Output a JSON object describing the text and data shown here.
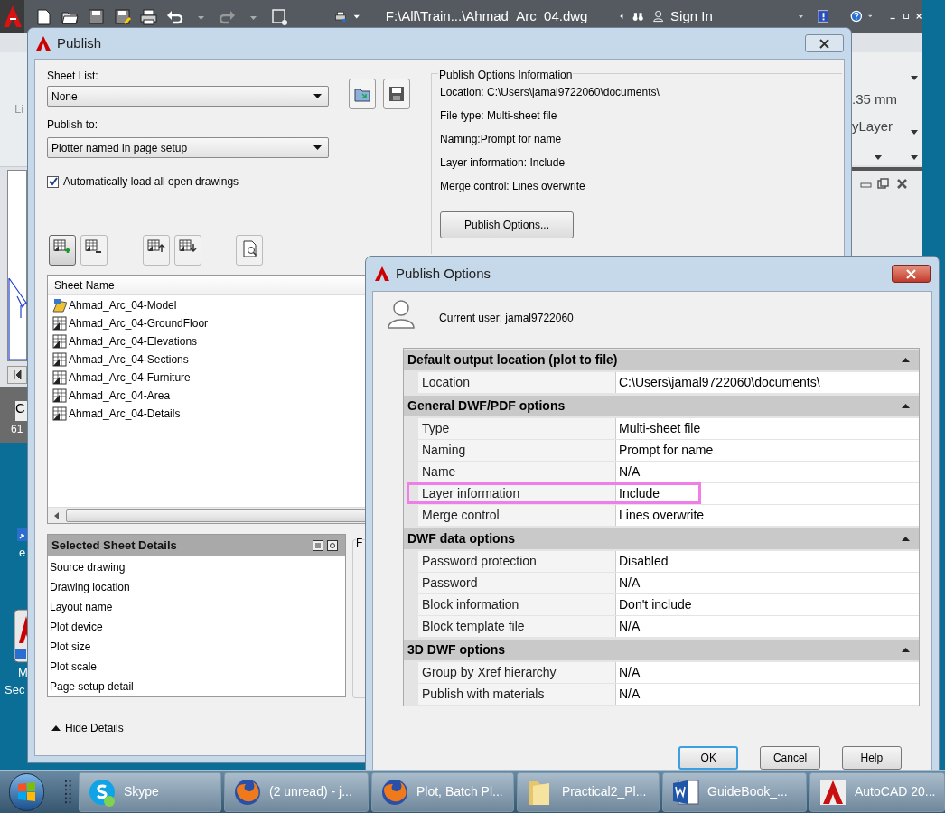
{
  "app_bar": {
    "title": "F:\\All\\Train...\\Ahmad_Arc_04.dwg",
    "sign_in": "Sign In"
  },
  "background_texts": [
    {
      "kind": "ribbon_label",
      "text": "Li"
    },
    {
      "kind": "lineweight",
      "text": ".35 mm"
    },
    {
      "kind": "linetype",
      "text": "yLayer"
    },
    {
      "kind": "layout_tab",
      "text": "C"
    },
    {
      "kind": "status",
      "text": "61"
    },
    {
      "kind": "desktop_icon_label",
      "text": "e"
    },
    {
      "kind": "desktop_icon_label2",
      "text": "M"
    },
    {
      "kind": "desktop_icon_label3",
      "text": "Sec"
    }
  ],
  "publish": {
    "title": "Publish",
    "sheet_list": {
      "label": "Sheet List:",
      "value": "None"
    },
    "publish_to": {
      "label": "Publish to:",
      "value": "Plotter named in page setup"
    },
    "auto_load": {
      "label": "Automatically load all open drawings",
      "checked": true
    },
    "info": {
      "title": "Publish Options Information",
      "lines": [
        "Location: C:\\Users\\jamal9722060\\documents\\",
        "File type: Multi-sheet file",
        "Naming:Prompt for name",
        "Layer information: Include",
        "Merge control: Lines overwrite"
      ]
    },
    "options_button": "Publish Options...",
    "sheets": {
      "column": "Sheet Name",
      "rows": [
        {
          "name": "Ahmad_Arc_04-Model",
          "kind": "model"
        },
        {
          "name": "Ahmad_Arc_04-GroundFloor",
          "kind": "layout"
        },
        {
          "name": "Ahmad_Arc_04-Elevations",
          "kind": "layout"
        },
        {
          "name": "Ahmad_Arc_04-Sections",
          "kind": "layout"
        },
        {
          "name": "Ahmad_Arc_04-Furniture",
          "kind": "layout"
        },
        {
          "name": "Ahmad_Arc_04-Area",
          "kind": "layout"
        },
        {
          "name": "Ahmad_Arc_04-Details",
          "kind": "layout"
        }
      ]
    },
    "details": {
      "title": "Selected Sheet Details",
      "rows": [
        "Source drawing",
        "Drawing location",
        "Layout name",
        "Plot device",
        "Plot size",
        "Plot scale",
        "Page setup detail"
      ]
    },
    "hide_details": "Hide Details",
    "side_group_label": "F"
  },
  "options_dialog": {
    "title": "Publish Options",
    "current_user": "Current user: jamal9722060",
    "sections": [
      {
        "title": "Default output location (plot to file)",
        "expanded": true,
        "rows": [
          {
            "label": "Location",
            "value": "C:\\Users\\jamal9722060\\documents\\",
            "highlighted": false
          }
        ]
      },
      {
        "title": "General DWF/PDF options",
        "expanded": true,
        "rows": [
          {
            "label": "Type",
            "value": "Multi-sheet file",
            "highlighted": false
          },
          {
            "label": "Naming",
            "value": "Prompt for name",
            "highlighted": false
          },
          {
            "label": "Name",
            "value": "N/A",
            "highlighted": false
          },
          {
            "label": "Layer information",
            "value": "Include",
            "highlighted": true
          },
          {
            "label": "Merge control",
            "value": "Lines overwrite",
            "highlighted": false
          }
        ]
      },
      {
        "title": "DWF data options",
        "expanded": true,
        "rows": [
          {
            "label": "Password protection",
            "value": "Disabled",
            "highlighted": false
          },
          {
            "label": "Password",
            "value": "N/A",
            "highlighted": false
          },
          {
            "label": "Block information",
            "value": "Don't include",
            "highlighted": false
          },
          {
            "label": "Block template file",
            "value": "N/A",
            "highlighted": false
          }
        ]
      },
      {
        "title": "3D DWF options",
        "expanded": true,
        "rows": [
          {
            "label": "Group by Xref hierarchy",
            "value": "N/A",
            "highlighted": false
          },
          {
            "label": "Publish with materials",
            "value": "N/A",
            "highlighted": false
          }
        ]
      }
    ],
    "buttons": [
      {
        "label": "OK",
        "focused": true
      },
      {
        "label": "Cancel",
        "focused": false
      },
      {
        "label": "Help",
        "focused": false
      }
    ]
  },
  "taskbar": {
    "items": [
      {
        "label": "Skype",
        "kind": "skype"
      },
      {
        "label": "(2 unread) - j...",
        "kind": "firefox"
      },
      {
        "label": "Plot, Batch Pl...",
        "kind": "firefox"
      },
      {
        "label": "Practical2_Pl...",
        "kind": "folder"
      },
      {
        "label": "GuideBook_...",
        "kind": "word"
      },
      {
        "label": "AutoCAD 20...",
        "kind": "autocad"
      }
    ]
  }
}
